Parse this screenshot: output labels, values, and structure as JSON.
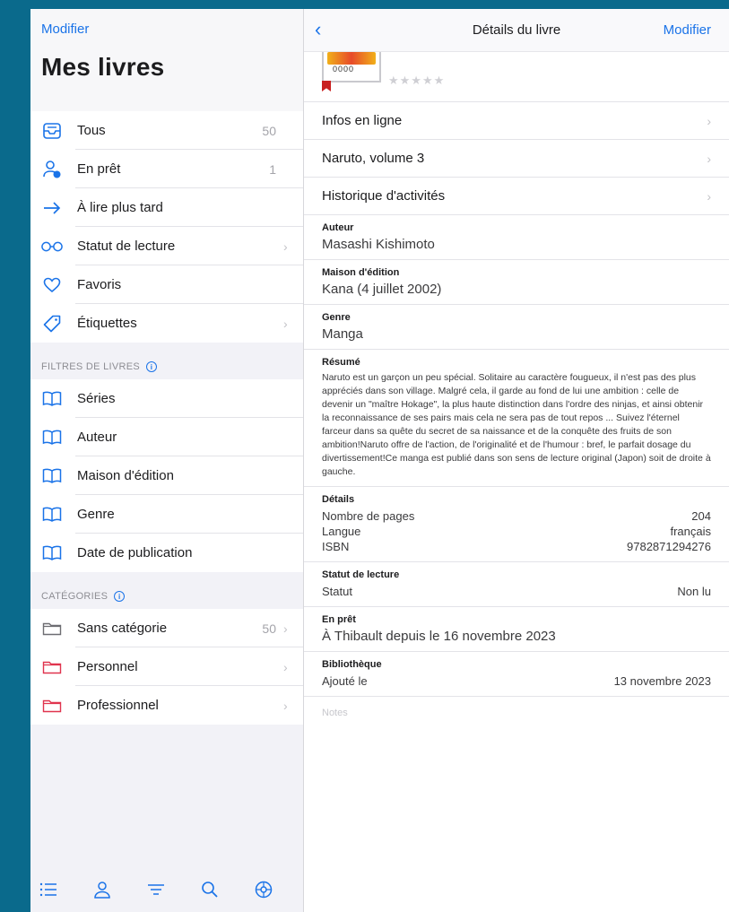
{
  "colors": {
    "accent": "#1a73e8",
    "background": "#0a6a8c",
    "folder_red": "#e0344e"
  },
  "sidebar": {
    "edit_label": "Modifier",
    "title": "Mes livres",
    "items": [
      {
        "label": "Tous",
        "count": "50",
        "icon": "tray-icon"
      },
      {
        "label": "En prêt",
        "count": "1",
        "icon": "person-loan-icon"
      },
      {
        "label": "À lire plus tard",
        "count": "",
        "icon": "arrow-right-icon"
      },
      {
        "label": "Statut de lecture",
        "count": "",
        "icon": "glasses-icon"
      },
      {
        "label": "Favoris",
        "count": "",
        "icon": "heart-icon"
      },
      {
        "label": "Étiquettes",
        "count": "",
        "icon": "tag-icon"
      }
    ],
    "filters_header": "FILTRES DE LIVRES",
    "filters": [
      {
        "label": "Séries"
      },
      {
        "label": "Auteur"
      },
      {
        "label": "Maison d'édition"
      },
      {
        "label": "Genre"
      },
      {
        "label": "Date de publication"
      }
    ],
    "categories_header": "CATÉGORIES",
    "categories": [
      {
        "label": "Sans catégorie",
        "count": "50"
      },
      {
        "label": "Personnel",
        "count": ""
      },
      {
        "label": "Professionnel",
        "count": ""
      }
    ]
  },
  "tabbar": {
    "icons": [
      "list-icon",
      "person-icon",
      "filter-icon",
      "search-icon",
      "settings-icon"
    ]
  },
  "detail": {
    "nav_title": "Détails du livre",
    "edit_label": "Modifier",
    "cover_text": "0000",
    "rating_stars": "★★★★★",
    "rating": 0,
    "links": [
      {
        "label": "Infos en ligne"
      },
      {
        "label": "Naruto, volume 3"
      },
      {
        "label": "Historique d'activités"
      }
    ],
    "author_label": "Auteur",
    "author": "Masashi Kishimoto",
    "publisher_label": "Maison d'édition",
    "publisher": "Kana (4 juillet 2002)",
    "genre_label": "Genre",
    "genre": "Manga",
    "summary_label": "Résumé",
    "summary": "Naruto est un garçon un peu spécial. Solitaire au caractère fougueux, il n'est pas des plus appréciés dans son village. Malgré cela, il garde au fond de lui une ambition : celle de devenir un \"maître Hokage\", la plus haute distinction dans l'ordre des ninjas, et ainsi obtenir la reconnaissance de ses pairs mais cela ne sera pas de tout repos ... Suivez l'éternel farceur dans sa quête du secret de sa naissance et de la conquête des fruits de son ambition!Naruto offre de l'action, de l'originalité et de l'humour : bref, le parfait dosage du divertissement!Ce manga est publié dans son sens de lecture original (Japon) soit de droite à gauche.",
    "details_label": "Détails",
    "details": [
      {
        "k": "Nombre de pages",
        "v": "204"
      },
      {
        "k": "Langue",
        "v": "français"
      },
      {
        "k": "ISBN",
        "v": "9782871294276"
      }
    ],
    "reading_label": "Statut de lecture",
    "reading_key": "Statut",
    "reading_value": "Non lu",
    "loan_label": "En prêt",
    "loan_value": "À Thibault depuis le 16 novembre 2023",
    "library_label": "Bibliothèque",
    "library_key": "Ajouté le",
    "library_value": "13 novembre 2023",
    "notes_placeholder": "Notes"
  }
}
